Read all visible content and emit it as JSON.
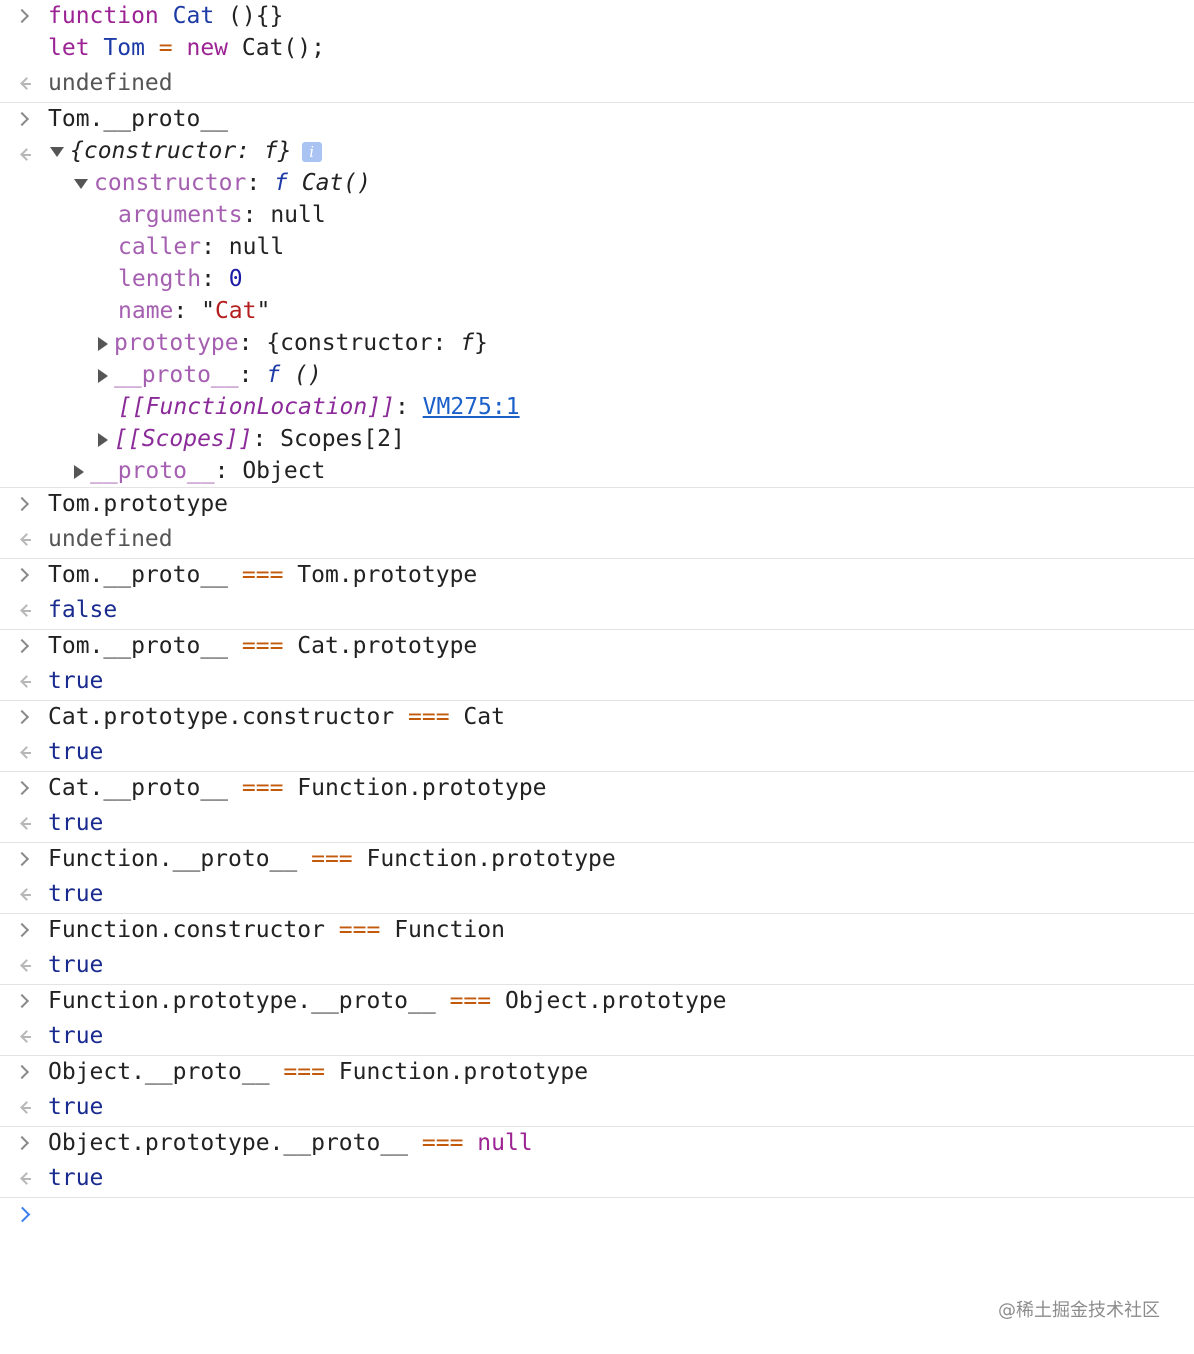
{
  "entries": [
    {
      "in_lines": [
        [
          {
            "t": "function ",
            "c": "kw"
          },
          {
            "t": "Cat",
            "c": "id"
          },
          {
            "t": " (){}",
            "c": ""
          }
        ],
        [
          {
            "t": "let ",
            "c": "kw"
          },
          {
            "t": "Tom",
            "c": "id"
          },
          {
            "t": " = ",
            "c": "op"
          },
          {
            "t": "new ",
            "c": "kw"
          },
          {
            "t": "Cat();",
            "c": ""
          }
        ]
      ],
      "out": [
        {
          "t": "undefined",
          "c": "muted"
        }
      ]
    },
    {
      "in_lines": [
        [
          {
            "t": "Tom.__proto__",
            "c": ""
          }
        ]
      ],
      "tree": true
    },
    {
      "in_lines": [
        [
          {
            "t": "Tom.prototype",
            "c": ""
          }
        ]
      ],
      "out": [
        {
          "t": "undefined",
          "c": "muted"
        }
      ]
    },
    {
      "in_lines": [
        [
          {
            "t": "Tom.__proto__ ",
            "c": ""
          },
          {
            "t": "===",
            "c": "op"
          },
          {
            "t": " Tom.prototype",
            "c": ""
          }
        ]
      ],
      "out": [
        {
          "t": "false",
          "c": "bool"
        }
      ]
    },
    {
      "in_lines": [
        [
          {
            "t": "Tom.__proto__ ",
            "c": ""
          },
          {
            "t": "===",
            "c": "op"
          },
          {
            "t": " Cat.prototype",
            "c": ""
          }
        ]
      ],
      "out": [
        {
          "t": "true",
          "c": "bool"
        }
      ]
    },
    {
      "in_lines": [
        [
          {
            "t": "Cat.prototype.constructor ",
            "c": ""
          },
          {
            "t": "===",
            "c": "op"
          },
          {
            "t": " Cat",
            "c": ""
          }
        ]
      ],
      "out": [
        {
          "t": "true",
          "c": "bool"
        }
      ]
    },
    {
      "in_lines": [
        [
          {
            "t": "Cat.__proto__ ",
            "c": ""
          },
          {
            "t": "===",
            "c": "op"
          },
          {
            "t": " Function.prototype",
            "c": ""
          }
        ]
      ],
      "out": [
        {
          "t": "true",
          "c": "bool"
        }
      ]
    },
    {
      "in_lines": [
        [
          {
            "t": "Function.__proto__ ",
            "c": ""
          },
          {
            "t": "===",
            "c": "op"
          },
          {
            "t": " Function.prototype",
            "c": ""
          }
        ]
      ],
      "out": [
        {
          "t": "true",
          "c": "bool"
        }
      ]
    },
    {
      "in_lines": [
        [
          {
            "t": "Function.constructor ",
            "c": ""
          },
          {
            "t": "===",
            "c": "op"
          },
          {
            "t": " Function",
            "c": ""
          }
        ]
      ],
      "out": [
        {
          "t": "true",
          "c": "bool"
        }
      ]
    },
    {
      "in_lines": [
        [
          {
            "t": "Function.prototype.__proto__ ",
            "c": ""
          },
          {
            "t": "===",
            "c": "op"
          },
          {
            "t": " Object.prototype",
            "c": ""
          }
        ]
      ],
      "out": [
        {
          "t": "true",
          "c": "bool"
        }
      ]
    },
    {
      "in_lines": [
        [
          {
            "t": "Object.__proto__ ",
            "c": ""
          },
          {
            "t": "===",
            "c": "op"
          },
          {
            "t": " Function.prototype",
            "c": ""
          }
        ]
      ],
      "out": [
        {
          "t": "true",
          "c": "bool"
        }
      ]
    },
    {
      "in_lines": [
        [
          {
            "t": "Object.prototype.__proto__ ",
            "c": ""
          },
          {
            "t": "===",
            "c": "op"
          },
          {
            "t": " null",
            "c": "kw"
          }
        ]
      ],
      "out": [
        {
          "t": "true",
          "c": "bool"
        }
      ]
    }
  ],
  "tree": [
    {
      "indent": 0,
      "tri": "down",
      "parts": [
        {
          "t": "{constructor: ",
          "c": "italic"
        },
        {
          "t": "f",
          "c": "italic"
        },
        {
          "t": "}",
          "c": "italic"
        }
      ],
      "info": "i"
    },
    {
      "indent": 1,
      "tri": "down",
      "parts": [
        {
          "t": "constructor",
          "c": "prop"
        },
        {
          "t": ": ",
          "c": ""
        },
        {
          "t": "f",
          "c": "fkw"
        },
        {
          "t": " Cat()",
          "c": "italic"
        }
      ]
    },
    {
      "indent": 2,
      "tri": "",
      "parts": [
        {
          "t": "arguments",
          "c": "prop"
        },
        {
          "t": ": null",
          "c": ""
        }
      ]
    },
    {
      "indent": 2,
      "tri": "",
      "parts": [
        {
          "t": "caller",
          "c": "prop"
        },
        {
          "t": ": null",
          "c": ""
        }
      ]
    },
    {
      "indent": 2,
      "tri": "",
      "parts": [
        {
          "t": "length",
          "c": "prop"
        },
        {
          "t": ": ",
          "c": ""
        },
        {
          "t": "0",
          "c": "num"
        }
      ]
    },
    {
      "indent": 2,
      "tri": "",
      "parts": [
        {
          "t": "name",
          "c": "prop"
        },
        {
          "t": ": \"",
          "c": ""
        },
        {
          "t": "Cat",
          "c": "str"
        },
        {
          "t": "\"",
          "c": ""
        }
      ]
    },
    {
      "indent": 2,
      "tri": "right",
      "parts": [
        {
          "t": "prototype",
          "c": "prop"
        },
        {
          "t": ": {constructor: ",
          "c": ""
        },
        {
          "t": "f",
          "c": "italic"
        },
        {
          "t": "}",
          "c": ""
        }
      ]
    },
    {
      "indent": 2,
      "tri": "right",
      "parts": [
        {
          "t": "__proto__",
          "c": "prop"
        },
        {
          "t": ": ",
          "c": ""
        },
        {
          "t": "f",
          "c": "fkw"
        },
        {
          "t": " ()",
          "c": "italic"
        }
      ]
    },
    {
      "indent": 2,
      "tri": "",
      "parts": [
        {
          "t": "[[FunctionLocation]]",
          "c": "internal"
        },
        {
          "t": ": ",
          "c": ""
        },
        {
          "t": "VM275:1",
          "c": "link"
        }
      ]
    },
    {
      "indent": 2,
      "tri": "right",
      "parts": [
        {
          "t": "[[Scopes]]",
          "c": "internal"
        },
        {
          "t": ": Scopes[2]",
          "c": ""
        }
      ]
    },
    {
      "indent": 1,
      "tri": "right",
      "parts": [
        {
          "t": "__proto__",
          "c": "prop"
        },
        {
          "t": ": Object",
          "c": ""
        }
      ]
    }
  ],
  "watermark": "@稀土掘金技术社区"
}
